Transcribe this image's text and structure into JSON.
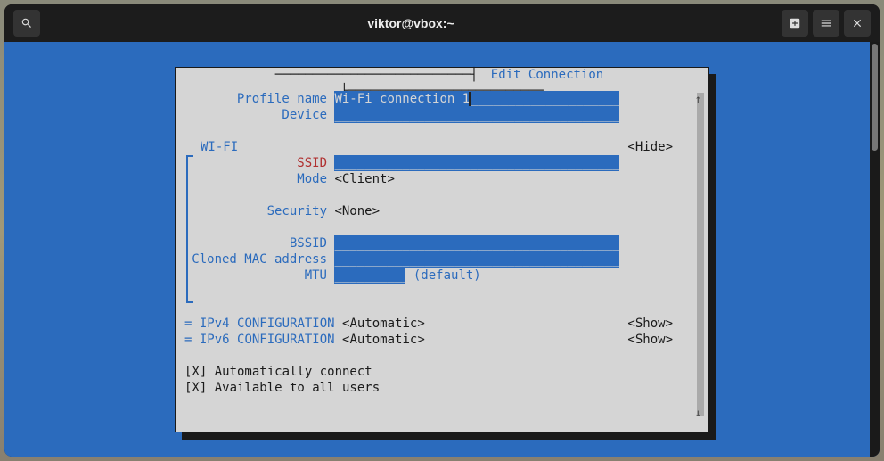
{
  "window": {
    "title": "viktor@vbox:~"
  },
  "tui": {
    "title": " Edit Connection ",
    "profile_name_label": "Profile name",
    "profile_name_value": "Wi-Fi connection 1",
    "device_label": "Device",
    "device_value": "",
    "wifi_section": "WI-FI",
    "wifi_hide": "<Hide>",
    "ssid_label": "SSID",
    "ssid_value": "",
    "mode_label": "Mode",
    "mode_value": "<Client>",
    "security_label": "Security",
    "security_value": "<None>",
    "bssid_label": "BSSID",
    "bssid_value": "",
    "cloned_mac_label": "Cloned MAC address",
    "cloned_mac_value": "",
    "mtu_label": "MTU",
    "mtu_value": "",
    "mtu_hint": " (default)",
    "ipv4_label": " IPv4 CONFIGURATION",
    "ipv4_value": "<Automatic>",
    "ipv4_show": "<Show>",
    "ipv6_label": " IPv6 CONFIGURATION",
    "ipv6_value": "<Automatic>",
    "ipv6_show": "<Show>",
    "auto_connect": "[X] Automatically connect",
    "avail_all": "[X] Available to all users",
    "underline_fill_40": "________________________________________",
    "underline_fill_tail": "______________________",
    "underline_fill_10": "__________",
    "equals": "="
  }
}
